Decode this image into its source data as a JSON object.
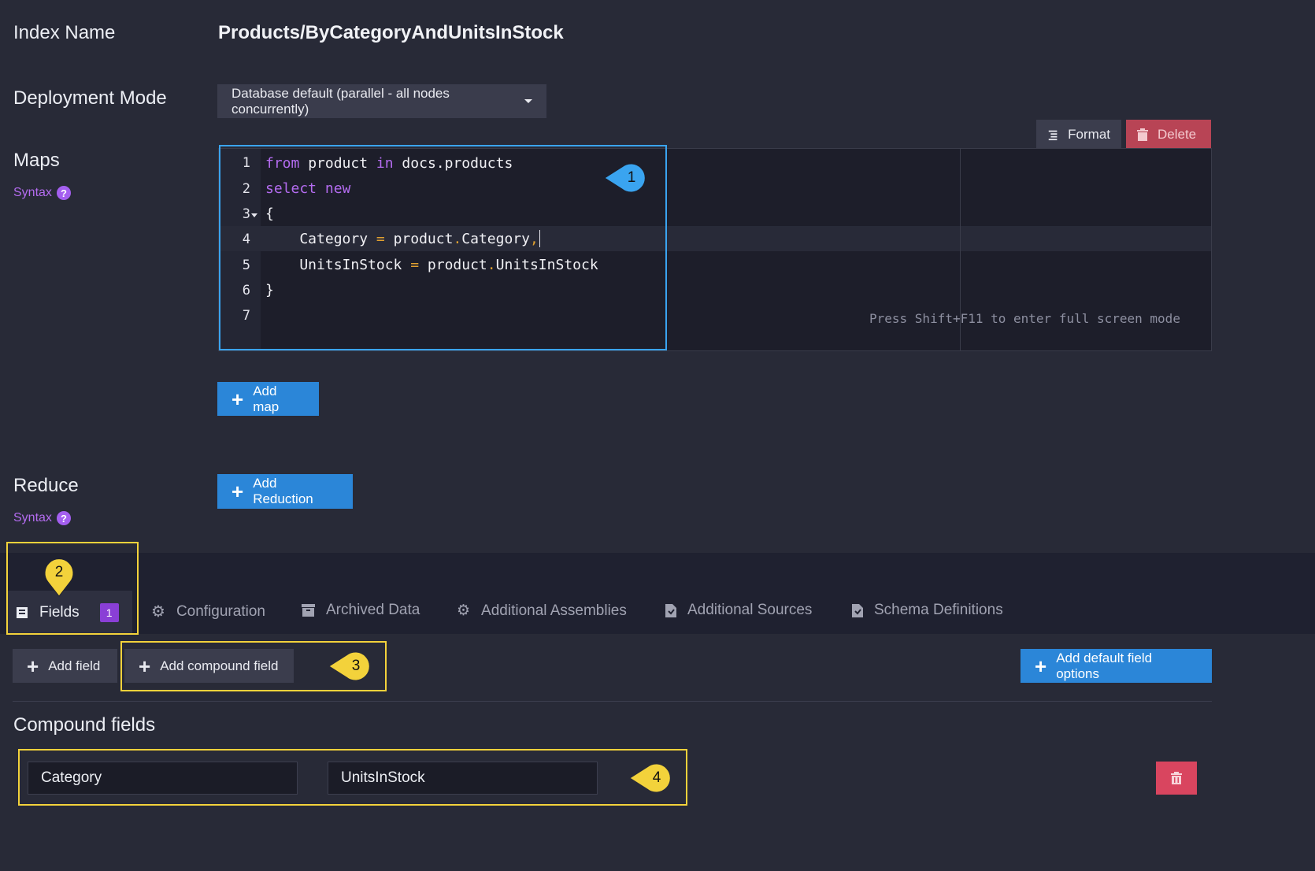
{
  "index": {
    "label": "Index Name",
    "name": "Products/ByCategoryAndUnitsInStock"
  },
  "deployment": {
    "label": "Deployment Mode",
    "value": "Database default (parallel - all nodes concurrently)"
  },
  "maps": {
    "label": "Maps",
    "syntax": "Syntax",
    "format_label": "Format",
    "delete_label": "Delete",
    "full_screen_hint": "Press Shift+F11 to enter full screen mode",
    "line_numbers": [
      "1",
      "2",
      "3",
      "4",
      "5",
      "6",
      "7"
    ],
    "add_map_label": "Add map"
  },
  "reduce": {
    "label": "Reduce",
    "syntax": "Syntax",
    "add_reduction_label": "Add Reduction"
  },
  "tabs": [
    {
      "label": "Fields",
      "badge": "1",
      "icon": "list-icon"
    },
    {
      "label": "Configuration",
      "icon": "gear-icon"
    },
    {
      "label": "Archived Data",
      "icon": "archive-icon"
    },
    {
      "label": "Additional Assemblies",
      "icon": "gears-icon"
    },
    {
      "label": "Additional Sources",
      "icon": "file-icon"
    },
    {
      "label": "Schema Definitions",
      "icon": "file-icon"
    }
  ],
  "fields": {
    "add_field_label": "Add field",
    "add_compound_label": "Add compound field",
    "add_default_options_label": "Add default field options",
    "compound_title": "Compound fields",
    "compound": [
      "Category",
      "UnitsInStock"
    ]
  },
  "callouts": [
    "1",
    "2",
    "3",
    "4"
  ],
  "colors": {
    "accent_blue": "#2b86d8",
    "highlight_yellow": "#f3d23b",
    "callout_blue": "#3aa4f0",
    "danger": "#d9455f"
  }
}
